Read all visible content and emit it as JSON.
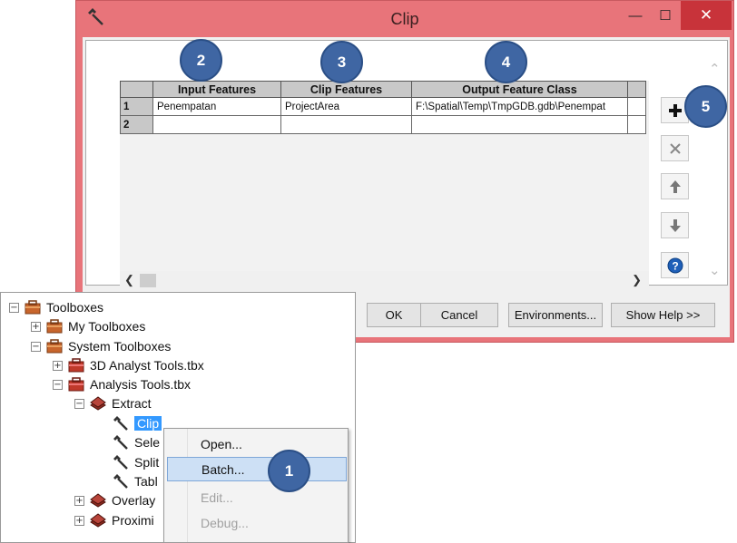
{
  "window": {
    "title": "Clip",
    "minimize_glyph": "—",
    "maximize_glyph": "☐",
    "close_glyph": "✕"
  },
  "grid": {
    "headers": [
      "Input Features",
      "Clip Features",
      "Output Feature Class"
    ],
    "rows": [
      {
        "num": "1",
        "input": "Penempatan",
        "clip": "ProjectArea",
        "output": "F:\\Spatial\\Temp\\TmpGDB.gdb\\Penempat"
      },
      {
        "num": "2",
        "input": "",
        "clip": "",
        "output": ""
      }
    ]
  },
  "side_buttons": {
    "add_glyph": "✚",
    "delete_glyph": "✕",
    "up_glyph": "🡅",
    "down_glyph": "🡇",
    "help_glyph": "?"
  },
  "buttons": {
    "ok": "OK",
    "cancel": "Cancel",
    "environments": "Environments...",
    "show_help": "Show Help >>"
  },
  "callouts": [
    "1",
    "2",
    "3",
    "4",
    "5"
  ],
  "tree": {
    "toolboxes": "Toolboxes",
    "my_toolboxes": "My Toolboxes",
    "system_toolboxes": "System Toolboxes",
    "analyst_3d": "3D Analyst Tools.tbx",
    "analysis": "Analysis Tools.tbx",
    "extract": "Extract",
    "clip": "Clip",
    "select": "Sele",
    "split": "Split",
    "table": "Tabl",
    "overlay": "Overlay",
    "proximity": "Proximi"
  },
  "menu": {
    "open": "Open...",
    "batch": "Batch...",
    "edit": "Edit...",
    "debug": "Debug..."
  },
  "colors": {
    "title_bar": "#e8747a",
    "close_button": "#c8333a",
    "callout": "#3f66a3",
    "selection": "#3399ff",
    "menu_highlight": "#cde0f5"
  }
}
